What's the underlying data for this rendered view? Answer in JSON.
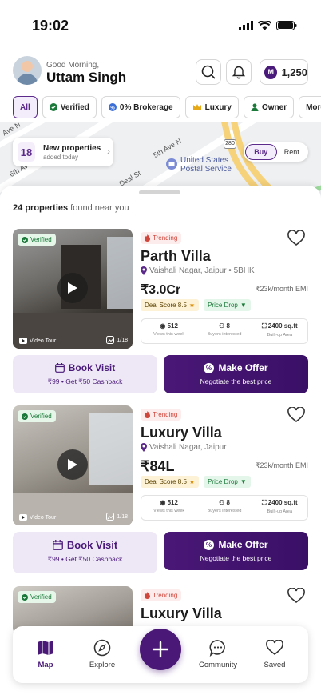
{
  "status": {
    "time": "19:02"
  },
  "header": {
    "greeting": "Good Morning,",
    "user_name": "Uttam Singh",
    "coin_badge": "M",
    "coins": "1,250"
  },
  "filters": [
    "All",
    "Verified",
    "0% Brokerage",
    "Luxury",
    "Owner",
    "More"
  ],
  "map": {
    "streets": [
      "Ave N",
      "6th Ave N",
      "5th Ave N",
      "Deal St"
    ],
    "poi": "United States Postal Service",
    "route": "280",
    "new_properties": {
      "count": "18",
      "title": "New properties",
      "subtitle": "added today"
    },
    "mode": {
      "buy": "Buy",
      "rent": "Rent",
      "selected": "Buy"
    }
  },
  "results": {
    "count": "24",
    "label": "properties",
    "suffix": "found near you"
  },
  "listings": [
    {
      "verified": "Verified",
      "trending": "Trending",
      "title": "Parth Villa",
      "location": "Vaishali Nagar, Jaipur • 5BHK",
      "price": "₹3.0Cr",
      "emi": "₹23k/month EMI",
      "deal_score": "Deal Score 8.5",
      "price_drop": "Price Drop",
      "stats": [
        {
          "value": "512",
          "label": "Views this week"
        },
        {
          "value": "8",
          "label": "Buyers interested"
        },
        {
          "value": "2400 sq.ft",
          "label": "Built-up Area"
        }
      ],
      "video_tour": "Video Tour",
      "gallery": "1/18",
      "book": {
        "label": "Book Visit",
        "sub": "₹99 • Get ₹50 Cashback"
      },
      "offer": {
        "label": "Make Offer",
        "sub": "Negotiate the best price"
      }
    },
    {
      "verified": "Verified",
      "trending": "Trending",
      "title": "Luxury Villa",
      "location": "Vaishali Nagar, Jaipur",
      "price": "₹84L",
      "emi": "₹23k/month EMI",
      "deal_score": "Deal Score 8.5",
      "price_drop": "Price Drop",
      "stats": [
        {
          "value": "512",
          "label": "Views this week"
        },
        {
          "value": "8",
          "label": "Buyers interested"
        },
        {
          "value": "2400 sq.ft",
          "label": "Built-up Area"
        }
      ],
      "video_tour": "Video Tour",
      "gallery": "1/18",
      "book": {
        "label": "Book Visit",
        "sub": "₹99 • Get ₹50 Cashback"
      },
      "offer": {
        "label": "Make Offer",
        "sub": "Negotiate the best price"
      }
    },
    {
      "verified": "Verified",
      "trending": "Trending",
      "title": "Luxury Villa"
    }
  ],
  "nav": {
    "map": "Map",
    "explore": "Explore",
    "community": "Community",
    "saved": "Saved"
  },
  "colors": {
    "brand": "#4a1877",
    "verified": "#1b7a3a",
    "trending": "#d0463b"
  }
}
